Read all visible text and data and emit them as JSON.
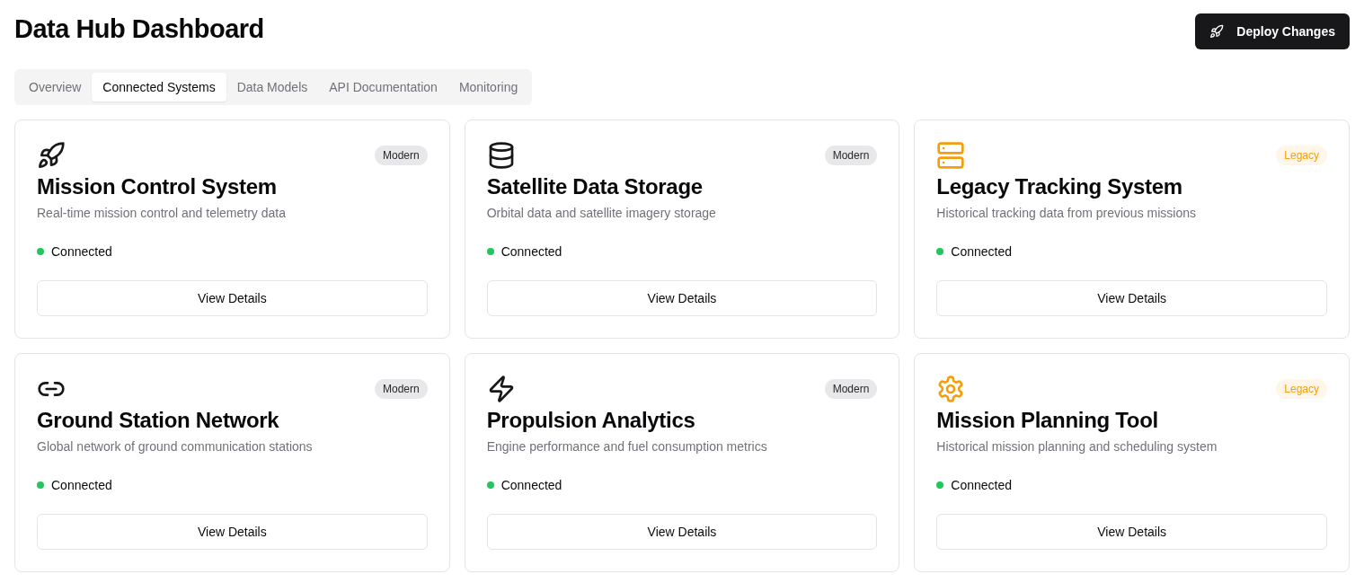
{
  "header": {
    "title": "Data Hub Dashboard",
    "action": "Deploy Changes"
  },
  "tabs": [
    {
      "label": "Overview",
      "selected": false
    },
    {
      "label": "Connected Systems",
      "selected": true
    },
    {
      "label": "Data Models",
      "selected": false
    },
    {
      "label": "API Documentation",
      "selected": false
    },
    {
      "label": "Monitoring",
      "selected": false
    }
  ],
  "systems": [
    {
      "name": "Mission Control System",
      "description": "Real-time mission control and telemetry data",
      "badge": "Modern",
      "kind": "modern",
      "status": "Connected",
      "connected": true,
      "action": "View Details"
    },
    {
      "name": "Satellite Data Storage",
      "description": "Orbital data and satellite imagery storage",
      "badge": "Modern",
      "kind": "modern",
      "status": "Connected",
      "connected": true,
      "action": "View Details"
    },
    {
      "name": "Legacy Tracking System",
      "description": "Historical tracking data from previous missions",
      "badge": "Legacy",
      "kind": "legacy",
      "status": "Connected",
      "connected": true,
      "action": "View Details"
    },
    {
      "name": "Ground Station Network",
      "description": "Global network of ground communication stations",
      "badge": "Modern",
      "kind": "modern",
      "status": "Connected",
      "connected": true,
      "action": "View Details"
    },
    {
      "name": "Propulsion Analytics",
      "description": "Engine performance and fuel consumption metrics",
      "badge": "Modern",
      "kind": "modern",
      "status": "Connected",
      "connected": true,
      "action": "View Details"
    },
    {
      "name": "Mission Planning Tool",
      "description": "Historical mission planning and scheduling system",
      "badge": "Legacy",
      "kind": "legacy",
      "status": "Connected",
      "connected": true,
      "action": "View Details"
    }
  ]
}
